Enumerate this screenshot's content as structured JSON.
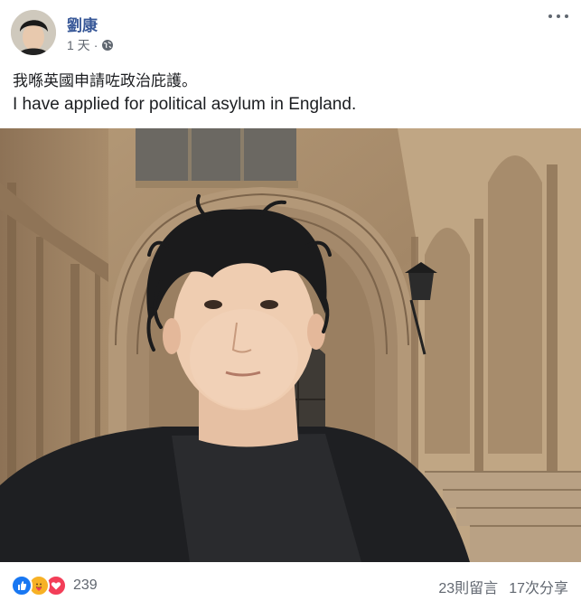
{
  "post": {
    "author": "劉康",
    "timestamp": "1 天",
    "separator": "·",
    "privacy_icon": "globe-icon",
    "more_icon": "more-options-icon",
    "text_line_1": "我喺英國申請咗政治庇護。",
    "text_line_2": "I have applied for political asylum in England."
  },
  "footer": {
    "reaction_icons": [
      "like-icon",
      "care-icon",
      "love-icon"
    ],
    "reaction_count": "239",
    "comments": "23則留言",
    "shares": "17次分享"
  },
  "colors": {
    "author": "#385898",
    "meta": "#616770",
    "like": "#1877f2",
    "care": "#f7b125",
    "love": "#f33e58"
  }
}
